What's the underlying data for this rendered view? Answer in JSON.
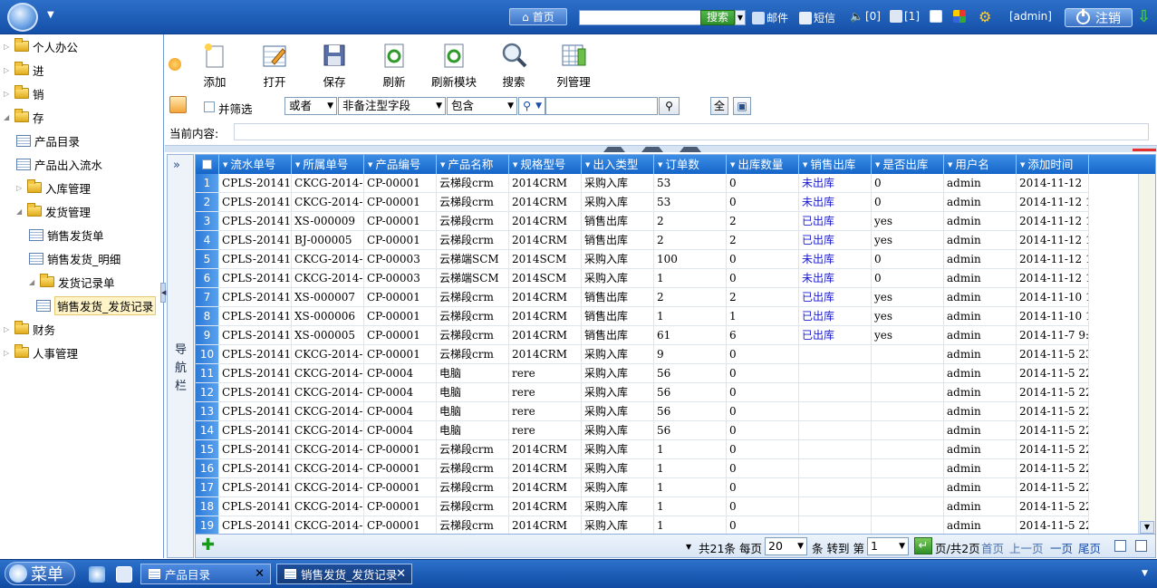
{
  "topbar": {
    "home": "首页",
    "search_btn": "搜索",
    "mail": "邮件",
    "sms": "短信",
    "sound_count": "[0]",
    "notice_count": "[1]",
    "user": "[admin]",
    "logout": "注销"
  },
  "sidebar": {
    "items": [
      {
        "label": "个人办公",
        "type": "folder",
        "level": 0
      },
      {
        "label": "进",
        "type": "folder",
        "level": 0
      },
      {
        "label": "销",
        "type": "folder",
        "level": 0
      },
      {
        "label": "存",
        "type": "folder-open",
        "level": 0
      },
      {
        "label": "产品目录",
        "type": "doc",
        "level": 1
      },
      {
        "label": "产品出入流水",
        "type": "doc",
        "level": 1
      },
      {
        "label": "入库管理",
        "type": "folder",
        "level": 1
      },
      {
        "label": "发货管理",
        "type": "folder-open",
        "level": 1
      },
      {
        "label": "销售发货单",
        "type": "doc",
        "level": 2
      },
      {
        "label": "销售发货_明细",
        "type": "doc",
        "level": 2
      },
      {
        "label": "发货记录单",
        "type": "folder-open",
        "level": 2
      },
      {
        "label": "销售发货_发货记录",
        "type": "doc",
        "level": 3
      },
      {
        "label": "财务",
        "type": "folder",
        "level": 0
      },
      {
        "label": "人事管理",
        "type": "folder",
        "level": 0
      }
    ]
  },
  "toolbar": {
    "add": "添加",
    "open": "打开",
    "save": "保存",
    "refresh": "刷新",
    "refresh_module": "刷新模块",
    "search": "搜索",
    "columns": "列管理"
  },
  "filter": {
    "and_filter": "并筛选",
    "logic": "或者",
    "field": "非备注型字段",
    "op": "包含",
    "all_btn": "全"
  },
  "current": {
    "label": "当前内容:"
  },
  "nav": {
    "label": "导航栏",
    "expand": "»"
  },
  "grid": {
    "columns": [
      "流水单号",
      "所属单号",
      "产品编号",
      "产品名称",
      "规格型号",
      "出入类型",
      "订单数",
      "出库数量",
      "销售出库",
      "是否出库",
      "用户名",
      "添加时间"
    ],
    "rows": [
      [
        "1",
        "CPLS-201411-",
        "CKCG-2014-",
        "CP-00001",
        "云梯段crm",
        "2014CRM",
        "采购入库",
        "53",
        "0",
        "未出库",
        "0",
        "admin",
        "2014-11-12"
      ],
      [
        "2",
        "CPLS-201411-0",
        "CKCG-2014-01",
        "CP-00001",
        "云梯段crm",
        "2014CRM",
        "采购入库",
        "53",
        "0",
        "未出库",
        "0",
        "admin",
        "2014-11-12 17:4"
      ],
      [
        "3",
        "CPLS-201411-0",
        "XS-000009",
        "CP-00001",
        "云梯段crm",
        "2014CRM",
        "销售出库",
        "2",
        "2",
        "已出库",
        "yes",
        "admin",
        "2014-11-12 17:3"
      ],
      [
        "4",
        "CPLS-201411-0",
        "BJ-000005",
        "CP-00001",
        "云梯段crm",
        "2014CRM",
        "销售出库",
        "2",
        "2",
        "已出库",
        "yes",
        "admin",
        "2014-11-12 17:2"
      ],
      [
        "5",
        "CPLS-201411-0",
        "CKCG-2014-01",
        "CP-00003",
        "云梯端SCM",
        "2014SCM",
        "采购入库",
        "100",
        "0",
        "未出库",
        "0",
        "admin",
        "2014-11-12 17:1"
      ],
      [
        "6",
        "CPLS-201411-0",
        "CKCG-2014-00",
        "CP-00003",
        "云梯端SCM",
        "2014SCM",
        "采购入库",
        "1",
        "0",
        "未出库",
        "0",
        "admin",
        "2014-11-12 16:4"
      ],
      [
        "7",
        "CPLS-201411-0",
        "XS-000007",
        "CP-00001",
        "云梯段crm",
        "2014CRM",
        "销售出库",
        "2",
        "2",
        "已出库",
        "yes",
        "admin",
        "2014-11-10 15:1"
      ],
      [
        "8",
        "CPLS-201411-0",
        "XS-000006",
        "CP-00001",
        "云梯段crm",
        "2014CRM",
        "销售出库",
        "1",
        "1",
        "已出库",
        "yes",
        "admin",
        "2014-11-10 14:5"
      ],
      [
        "9",
        "CPLS-201411-0",
        "XS-000005",
        "CP-00001",
        "云梯段crm",
        "2014CRM",
        "销售出库",
        "61",
        "6",
        "已出库",
        "yes",
        "admin",
        "2014-11-7 9:54:"
      ],
      [
        "10",
        "CPLS-201411-0",
        "CKCG-2014-00",
        "CP-00001",
        "云梯段crm",
        "2014CRM",
        "采购入库",
        "9",
        "0",
        "",
        "",
        "admin",
        "2014-11-5 23:30"
      ],
      [
        "11",
        "CPLS-201411-0",
        "CKCG-2014-00",
        "CP-0004",
        "电脑",
        "rere",
        "采购入库",
        "56",
        "0",
        "",
        "",
        "admin",
        "2014-11-5 22:53"
      ],
      [
        "12",
        "CPLS-201411-0",
        "CKCG-2014-00",
        "CP-0004",
        "电脑",
        "rere",
        "采购入库",
        "56",
        "0",
        "",
        "",
        "admin",
        "2014-11-5 22:53"
      ],
      [
        "13",
        "CPLS-201411-0",
        "CKCG-2014-00",
        "CP-0004",
        "电脑",
        "rere",
        "采购入库",
        "56",
        "0",
        "",
        "",
        "admin",
        "2014-11-5 22:53"
      ],
      [
        "14",
        "CPLS-201411-0",
        "CKCG-2014-00",
        "CP-0004",
        "电脑",
        "rere",
        "采购入库",
        "56",
        "0",
        "",
        "",
        "admin",
        "2014-11-5 22:52"
      ],
      [
        "15",
        "CPLS-201411-0",
        "CKCG-2014-00",
        "CP-00001",
        "云梯段crm",
        "2014CRM",
        "采购入库",
        "1",
        "0",
        "",
        "",
        "admin",
        "2014-11-5 22:44"
      ],
      [
        "16",
        "CPLS-201411-0",
        "CKCG-2014-00",
        "CP-00001",
        "云梯段crm",
        "2014CRM",
        "采购入库",
        "1",
        "0",
        "",
        "",
        "admin",
        "2014-11-5 22:40"
      ],
      [
        "17",
        "CPLS-201411-0",
        "CKCG-2014-00",
        "CP-00001",
        "云梯段crm",
        "2014CRM",
        "采购入库",
        "1",
        "0",
        "",
        "",
        "admin",
        "2014-11-5 22:39"
      ],
      [
        "18",
        "CPLS-201411-0",
        "CKCG-2014-00",
        "CP-00001",
        "云梯段crm",
        "2014CRM",
        "采购入库",
        "1",
        "0",
        "",
        "",
        "admin",
        "2014-11-5 22:39"
      ],
      [
        "19",
        "CPLS-201411-0",
        "CKCG-2014-00",
        "CP-00001",
        "云梯段crm",
        "2014CRM",
        "采购入库",
        "1",
        "0",
        "",
        "",
        "admin",
        "2014-11-5 22:38"
      ]
    ]
  },
  "pager": {
    "total": "共21条",
    "per_page_label": "每页",
    "per_page": "20",
    "unit_goto": "条 转到 第",
    "page": "1",
    "page_info": "页/共2页",
    "first": "首页",
    "prev": "上一页",
    "next": "一页",
    "last": "尾页"
  },
  "taskbar": {
    "menu": "菜单",
    "tabs": [
      "产品目录",
      "销售发货_发货记录"
    ]
  },
  "colors": {
    "header_blue": "#1565c9",
    "sold_blue": "#1a1ad0",
    "accent_green": "#2f8f2a"
  }
}
